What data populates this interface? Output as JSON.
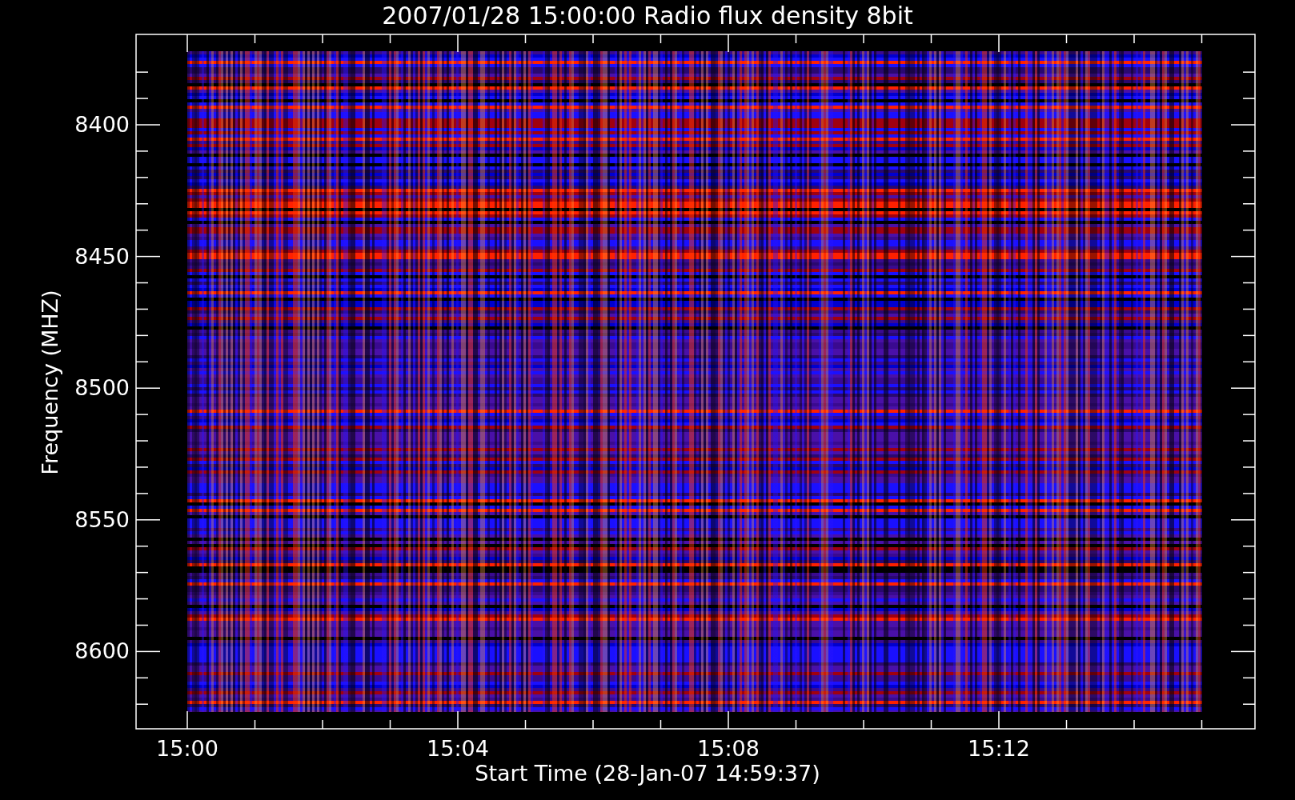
{
  "title": "2007/01/28 15:00:00 Radio flux density 8bit",
  "xlabel": "Start Time (28-Jan-07 14:59:37)",
  "ylabel": "Frequency (MHZ)",
  "xticks": [
    "15:00",
    "15:04",
    "15:08",
    "15:12"
  ],
  "yticks": [
    "8400",
    "8450",
    "8500",
    "8550",
    "8600"
  ]
}
